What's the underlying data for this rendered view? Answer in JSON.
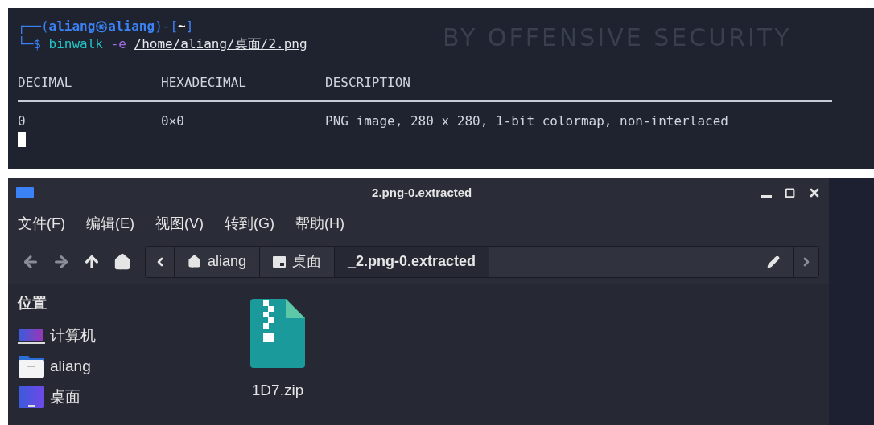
{
  "terminal": {
    "wallpaper_text": "BY OFFENSIVE SECURITY",
    "prompt": {
      "open": "┌──(",
      "user": "aliang㉿aliang",
      "mid": ")-[",
      "dir": "~",
      "close": "]",
      "line2": "└─$",
      "command": "binwalk",
      "option": "-e",
      "path": "/home/aliang/桌面/2.png"
    },
    "columns": [
      "DECIMAL",
      "HEXADECIMAL",
      "DESCRIPTION"
    ],
    "rows": [
      [
        "0",
        "0×0",
        "PNG image, 280 x 280, 1-bit colormap, non-interlaced"
      ]
    ]
  },
  "file_manager": {
    "window": {
      "title": "_2.png-0.extracted"
    },
    "menu": [
      "文件(F)",
      "编辑(E)",
      "视图(V)",
      "转到(G)",
      "帮助(H)"
    ],
    "path": [
      {
        "label": "aliang",
        "kind": "home",
        "selected": false
      },
      {
        "label": "桌面",
        "kind": "drive",
        "selected": false
      },
      {
        "label": "_2.png-0.extracted",
        "kind": "folder",
        "selected": true
      }
    ],
    "sidebar": {
      "heading": "位置",
      "items": [
        {
          "label": "计算机",
          "kind": "computer"
        },
        {
          "label": "aliang",
          "kind": "home"
        },
        {
          "label": "桌面",
          "kind": "desktop"
        }
      ]
    },
    "files": [
      {
        "name": "1D7.zip",
        "kind": "zip"
      }
    ]
  }
}
